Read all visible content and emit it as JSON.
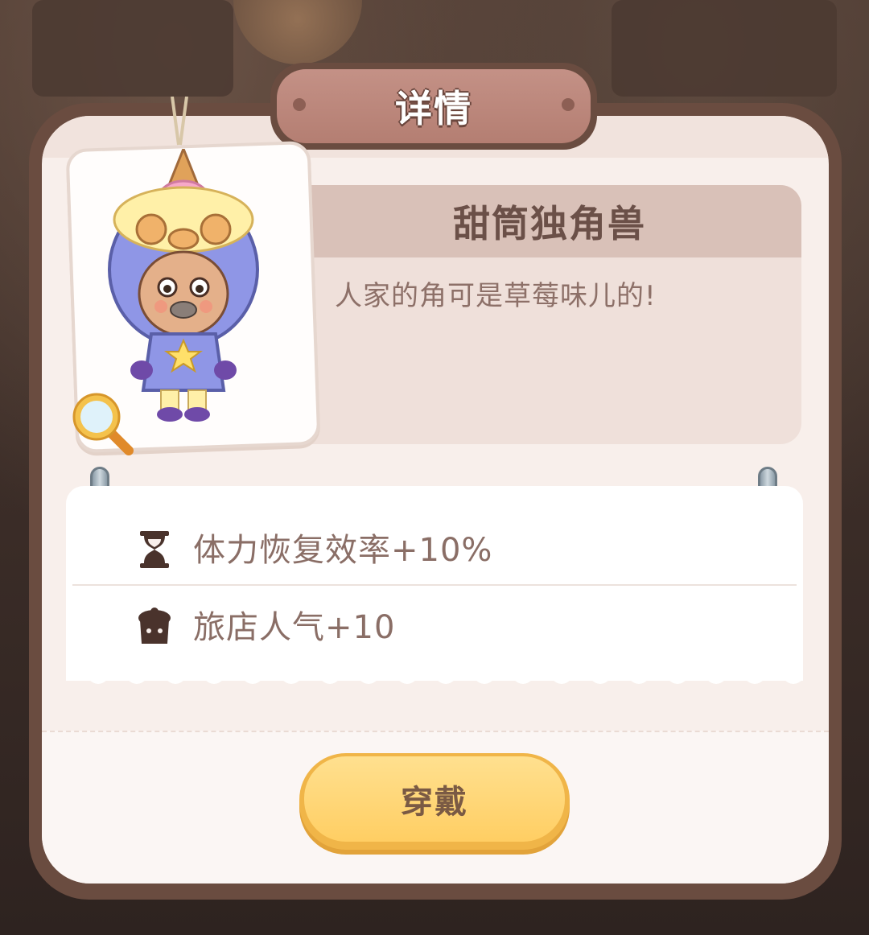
{
  "dialog": {
    "title": "详情"
  },
  "item": {
    "name": "甜筒独角兽",
    "description": "人家的角可是草莓味儿的!"
  },
  "effects": [
    {
      "icon": "hourglass-icon",
      "text": "体力恢复效率+10%"
    },
    {
      "icon": "popularity-cake-icon",
      "text": "旅店人气+10"
    }
  ],
  "actions": {
    "wear_label": "穿戴"
  },
  "colors": {
    "panel_border": "#6a4c40",
    "panel_fill": "#f8efeb",
    "title_plaque": "#b47e72",
    "button_fill": "#ffce63",
    "text_brown": "#8a6e66"
  }
}
